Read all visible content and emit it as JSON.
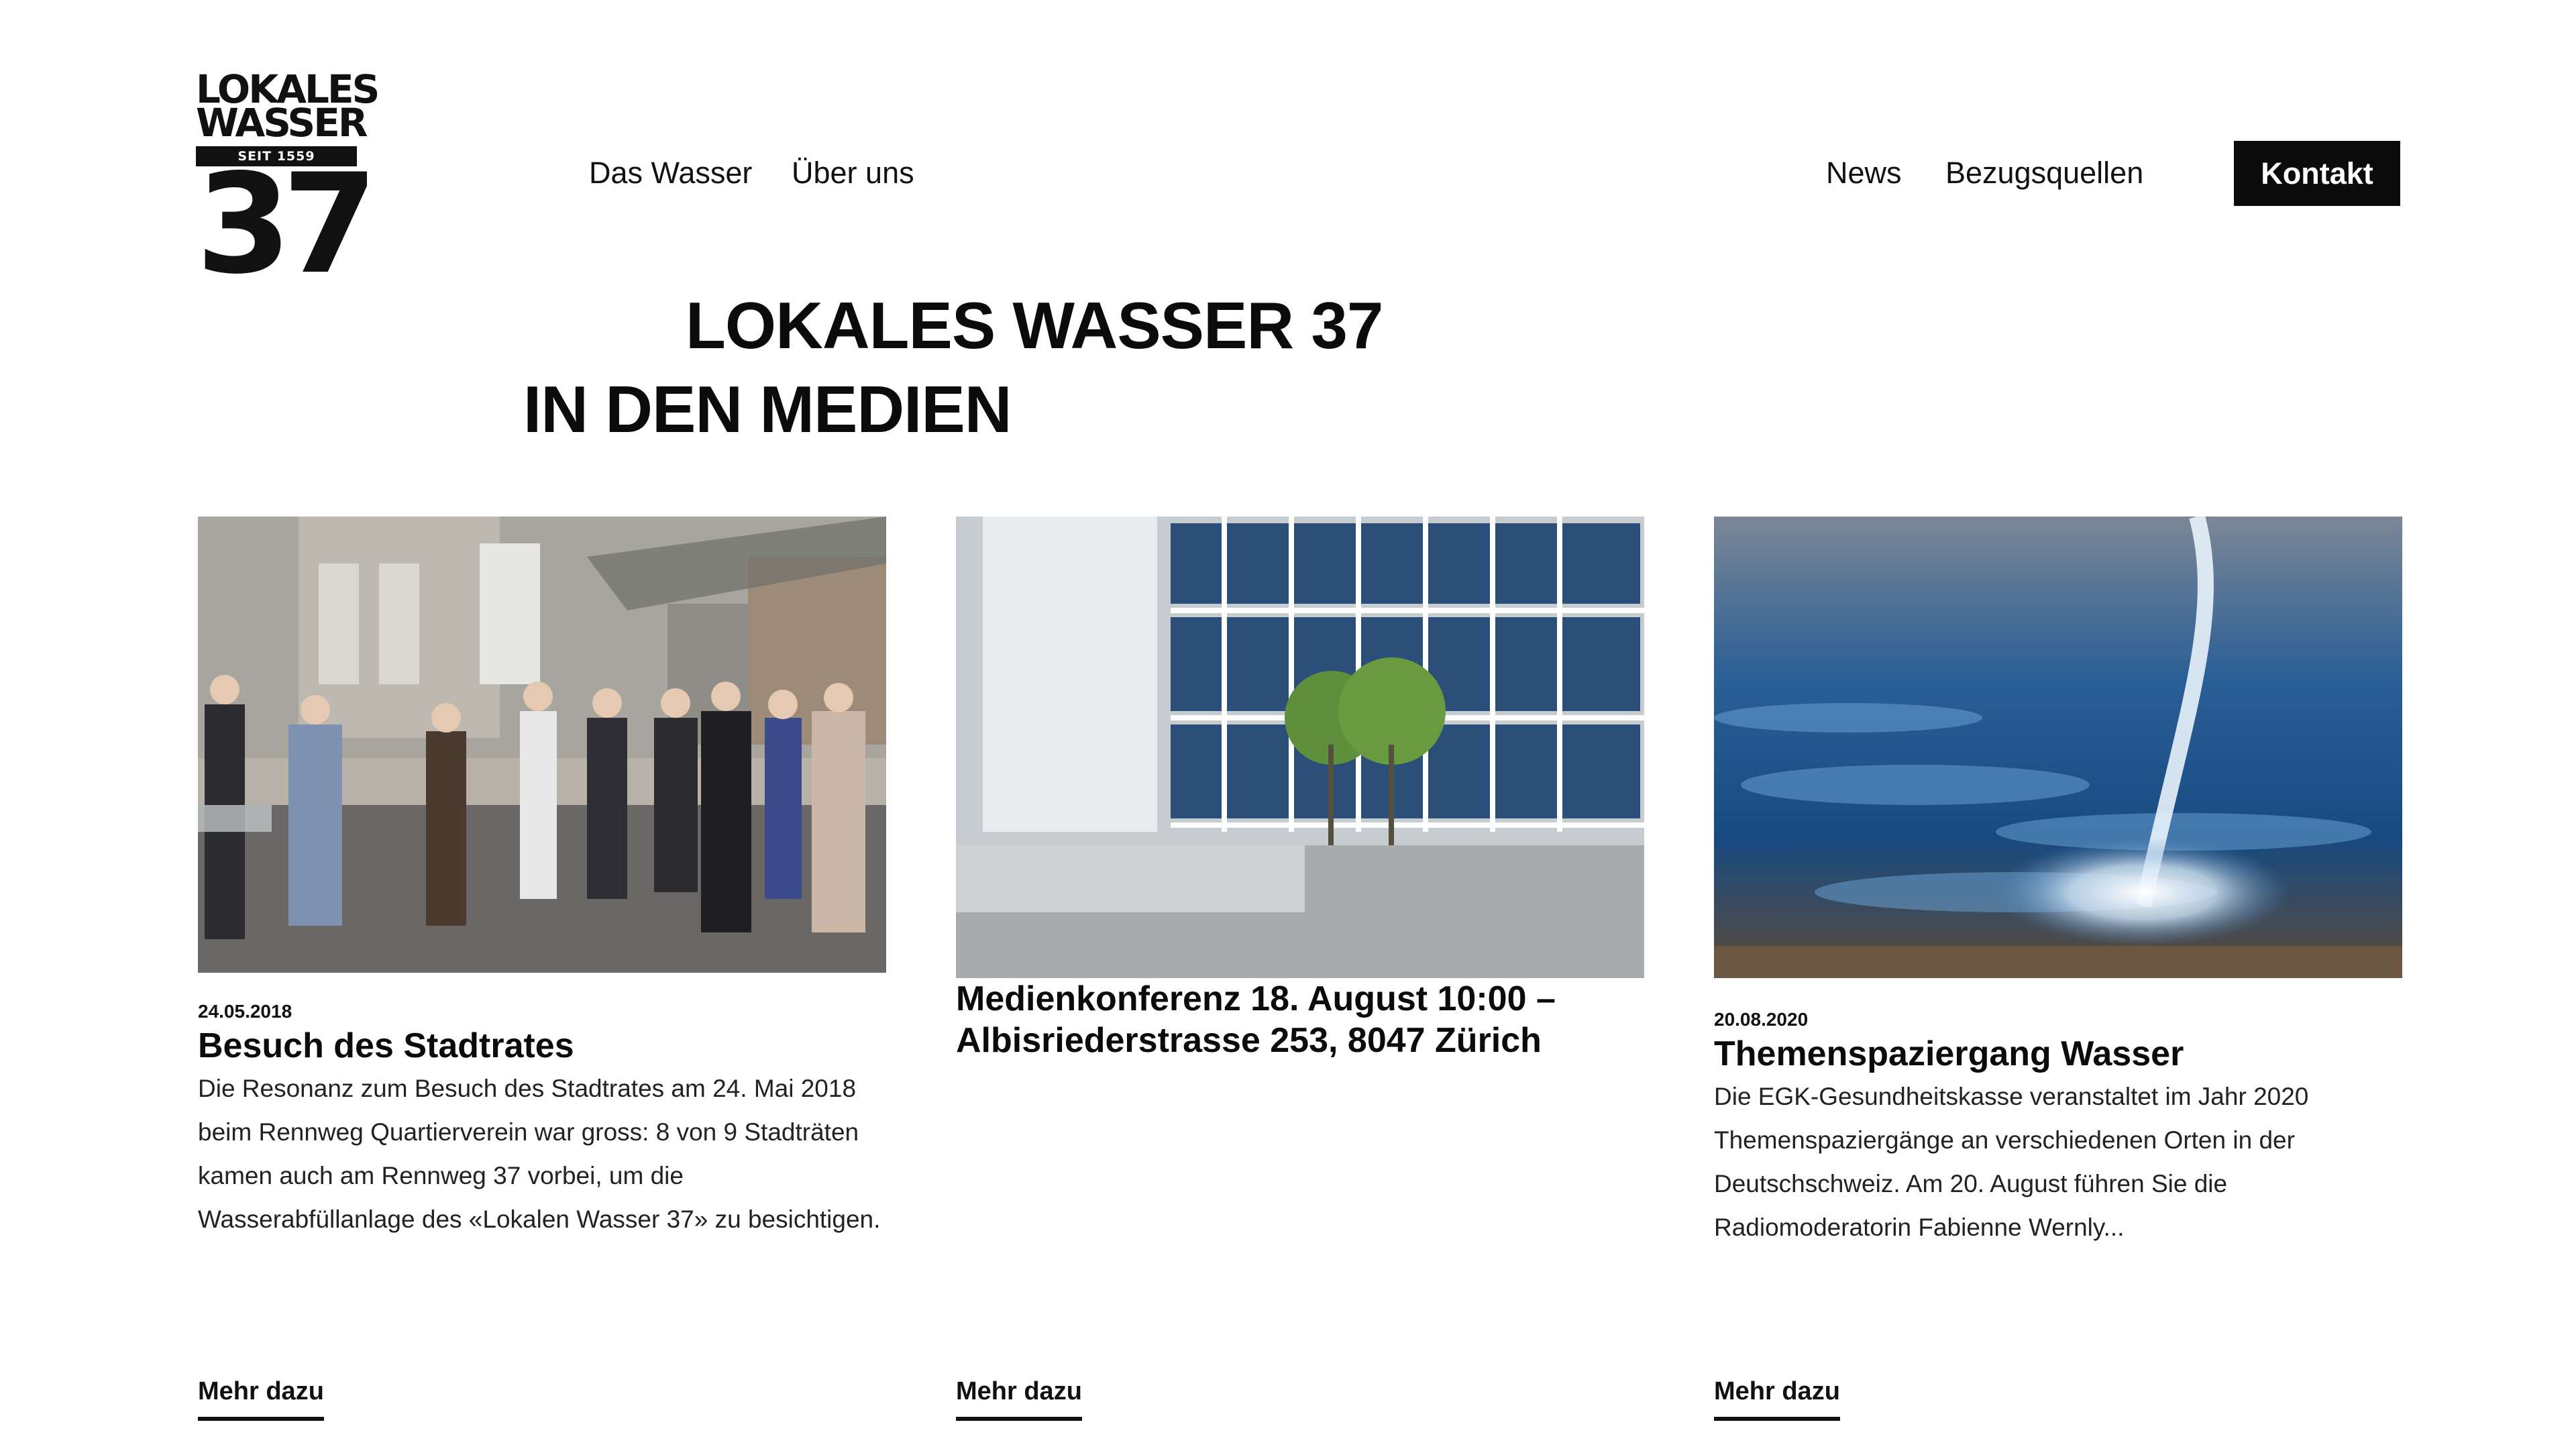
{
  "logo": {
    "line1": "LOKALES",
    "line2": "WASSER",
    "badge": "SEIT 1559",
    "number": "37"
  },
  "nav": {
    "left": [
      "Das Wasser",
      "Über uns"
    ],
    "right": [
      "News",
      "Bezugsquellen"
    ],
    "cta": "Kontakt"
  },
  "headline": {
    "line1": "LOKALES WASSER 37",
    "line2": "IN DEN MEDIEN"
  },
  "cards": [
    {
      "image": "group-of-people-applauding-photo",
      "date": "24.05.2018",
      "title": "Besuch des Stadtrates",
      "excerpt": "Die Resonanz zum Besuch des Stadtrates am 24. Mai 2018 beim Rennweg Quartierverein war gross: 8 von 9 Stadträten kamen auch am Rennweg 37 vorbei, um die Wasserabfüllanlage des «Lokalen Wasser 37» zu besichtigen.",
      "more": "Mehr dazu"
    },
    {
      "image": "glass-office-building-photo",
      "date": "",
      "title": "Medienkonferenz 18. August 10:00 – Albisriederstrasse 253, 8047 Zürich",
      "excerpt": "",
      "more": "Mehr dazu"
    },
    {
      "image": "water-stream-splash-photo",
      "date": "20.08.2020",
      "title": "Themenspaziergang Wasser",
      "excerpt": "Die EGK-Gesundheitskasse veranstaltet im Jahr 2020 Themenspaziergänge an verschiedenen Orten in der Deutschschweiz. Am 20. August führen Sie die Radiomoderatorin Fabienne Wernly...",
      "more": "Mehr dazu"
    }
  ],
  "colors": {
    "text": "#111111",
    "button_bg": "#0b0b0b",
    "button_text": "#ffffff",
    "background": "#ffffff"
  }
}
